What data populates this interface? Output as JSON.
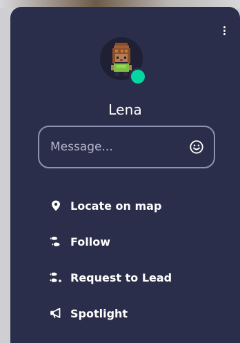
{
  "profile": {
    "name": "Lena",
    "status": "online",
    "status_color": "#06d6a0"
  },
  "message": {
    "placeholder": "Message...",
    "value": "",
    "emoji_icon": "smiley-icon"
  },
  "menu": {
    "items": [
      {
        "label": "Locate on map",
        "icon": "map-pin-icon"
      },
      {
        "label": "Follow",
        "icon": "footsteps-icon"
      },
      {
        "label": "Request to Lead",
        "icon": "footsteps-lead-icon"
      },
      {
        "label": "Spotlight",
        "icon": "megaphone-icon"
      }
    ]
  },
  "colors": {
    "panel_bg": "#2b2e4a",
    "text": "#ffffff",
    "input_border": "#8e92b3",
    "placeholder": "#b3b6cc"
  }
}
